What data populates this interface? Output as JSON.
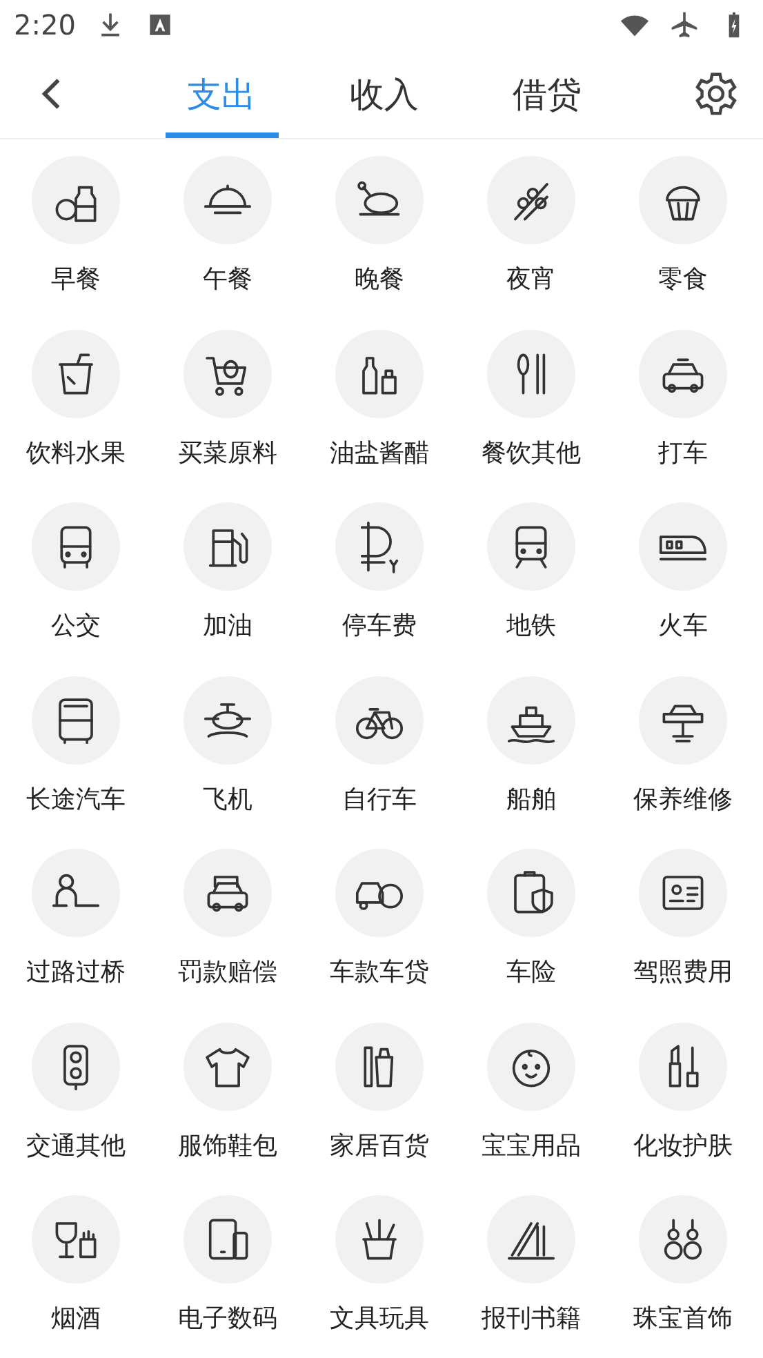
{
  "status_bar": {
    "time": "2:20"
  },
  "header": {
    "tabs": [
      {
        "label": "支出",
        "selected": true
      },
      {
        "label": "收入",
        "selected": false
      },
      {
        "label": "借贷",
        "selected": false
      }
    ]
  },
  "categories": [
    {
      "label": "早餐"
    },
    {
      "label": "午餐"
    },
    {
      "label": "晚餐"
    },
    {
      "label": "夜宵"
    },
    {
      "label": "零食"
    },
    {
      "label": "饮料水果"
    },
    {
      "label": "买菜原料"
    },
    {
      "label": "油盐酱醋"
    },
    {
      "label": "餐饮其他"
    },
    {
      "label": "打车"
    },
    {
      "label": "公交"
    },
    {
      "label": "加油"
    },
    {
      "label": "停车费"
    },
    {
      "label": "地铁"
    },
    {
      "label": "火车"
    },
    {
      "label": "长途汽车"
    },
    {
      "label": "飞机"
    },
    {
      "label": "自行车"
    },
    {
      "label": "船舶"
    },
    {
      "label": "保养维修"
    },
    {
      "label": "过路过桥"
    },
    {
      "label": "罚款赔偿"
    },
    {
      "label": "车款车贷"
    },
    {
      "label": "车险"
    },
    {
      "label": "驾照费用"
    },
    {
      "label": "交通其他"
    },
    {
      "label": "服饰鞋包"
    },
    {
      "label": "家居百货"
    },
    {
      "label": "宝宝用品"
    },
    {
      "label": "化妆护肤"
    },
    {
      "label": "烟酒"
    },
    {
      "label": "电子数码"
    },
    {
      "label": "文具玩具"
    },
    {
      "label": "报刊书籍"
    },
    {
      "label": "珠宝首饰"
    }
  ]
}
